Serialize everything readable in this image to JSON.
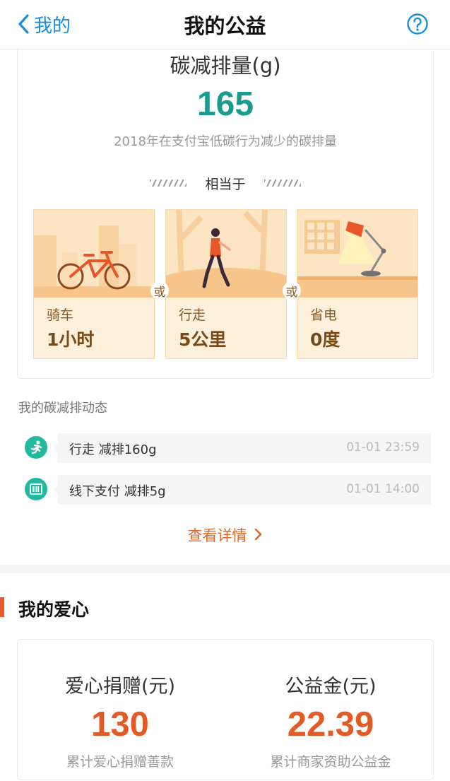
{
  "nav": {
    "back_label": "我的",
    "title": "我的公益"
  },
  "carbon": {
    "label": "碳减排量(g)",
    "value": "165",
    "subtitle": "2018年在支付宝低碳行为减少的碳排量",
    "equivalent_label": "相当于",
    "or_label": "或",
    "tiles": [
      {
        "label": "骑车",
        "value": "1小时",
        "icon": "bicycle-icon"
      },
      {
        "label": "行走",
        "value": "5公里",
        "icon": "walking-person-icon"
      },
      {
        "label": "省电",
        "value": "0度",
        "icon": "desk-lamp-icon"
      }
    ]
  },
  "dynamics": {
    "title": "我的碳减排动态",
    "items": [
      {
        "text": "行走  减排160g",
        "time": "01-01 23:59",
        "icon": "runner-icon"
      },
      {
        "text": "线下支付  减排5g",
        "time": "01-01 14:00",
        "icon": "barcode-icon"
      }
    ],
    "more_label": "查看详情"
  },
  "love": {
    "title": "我的爱心",
    "donation": {
      "label": "爱心捐赠(元)",
      "value": "130",
      "subtitle": "累计爱心捐赠善款"
    },
    "fund": {
      "label": "公益金(元)",
      "value": "22.39",
      "subtitle": "累计商家资助公益金"
    }
  },
  "colors": {
    "accent_blue": "#1a8cdf",
    "carbon_green": "#1a9b8f",
    "icon_green": "#21b9a0",
    "orange": "#e35a24",
    "tile_bg": "#fdf0db"
  }
}
